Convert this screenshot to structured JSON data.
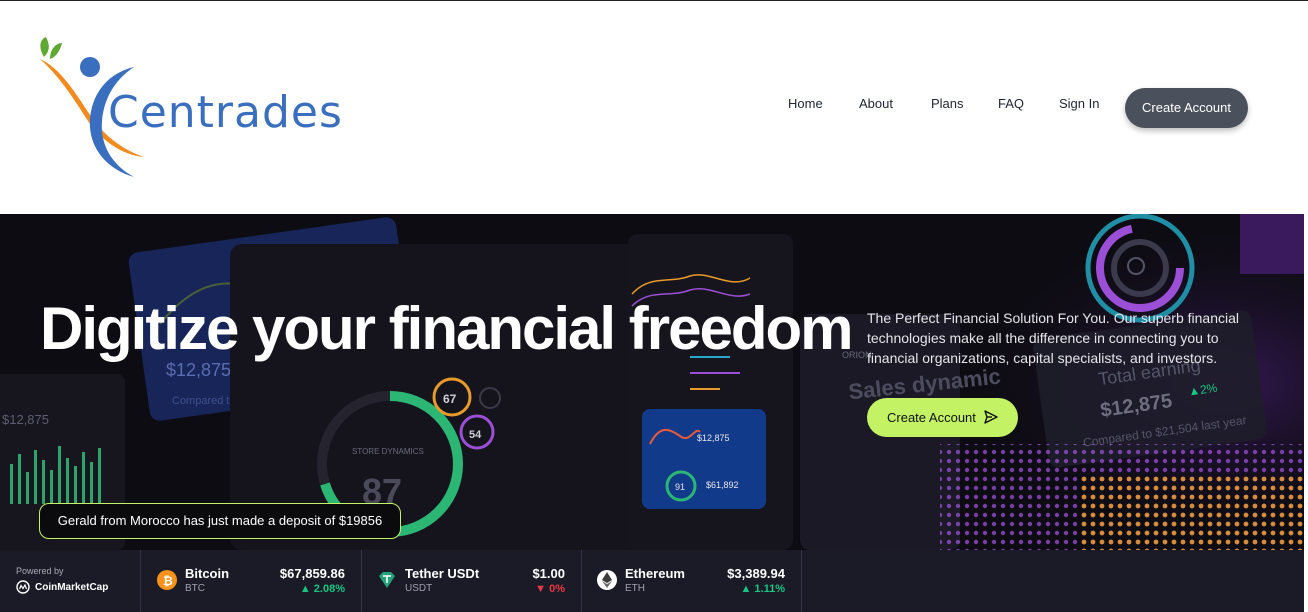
{
  "brand": {
    "name": "Centrades",
    "colors": {
      "blue": "#3a6fbf",
      "orange": "#f28a1e",
      "green": "#5fa832"
    }
  },
  "nav": {
    "items": [
      "Home",
      "About",
      "Plans",
      "FAQ",
      "Sign In"
    ],
    "cta_label": "Create Account"
  },
  "hero": {
    "title": "Digitize your financial freedom",
    "subtitle": "The Perfect Financial Solution For You. Our superb financial technologies make all the difference in connecting you to financial organizations, capital specialists, and investors.",
    "cta_label": "Create Account",
    "cta_icon": "send-icon",
    "notification": "Gerald from Morocco has just made a deposit of $19856",
    "accent_color": "#c3f265",
    "background_mockup": {
      "card_value": "$12,875",
      "card_delta": "2%",
      "card_compare": "Compared to $21,504 last year",
      "card_title": "Total earning",
      "sales_title": "Sales dynamic",
      "store_label": "STORE DYNAMICS",
      "store_value": "87",
      "gauge_a": "67",
      "gauge_b": "54",
      "orion_label": "ORION"
    }
  },
  "ticker": {
    "powered_by_label": "Powered by",
    "powered_by_brand": "CoinMarketCap",
    "coins": [
      {
        "name": "Bitcoin",
        "symbol": "BTC",
        "price": "$67,859.86",
        "change": "2.08%",
        "direction": "up",
        "icon": "bitcoin-icon",
        "color": "#f7931a"
      },
      {
        "name": "Tether USDt",
        "symbol": "USDT",
        "price": "$1.00",
        "change": "0%",
        "direction": "down",
        "icon": "tether-icon",
        "color": "#26a17b"
      },
      {
        "name": "Ethereum",
        "symbol": "ETH",
        "price": "$3,389.94",
        "change": "1.11%",
        "direction": "up",
        "icon": "ethereum-icon",
        "color": "#ffffff"
      }
    ]
  }
}
